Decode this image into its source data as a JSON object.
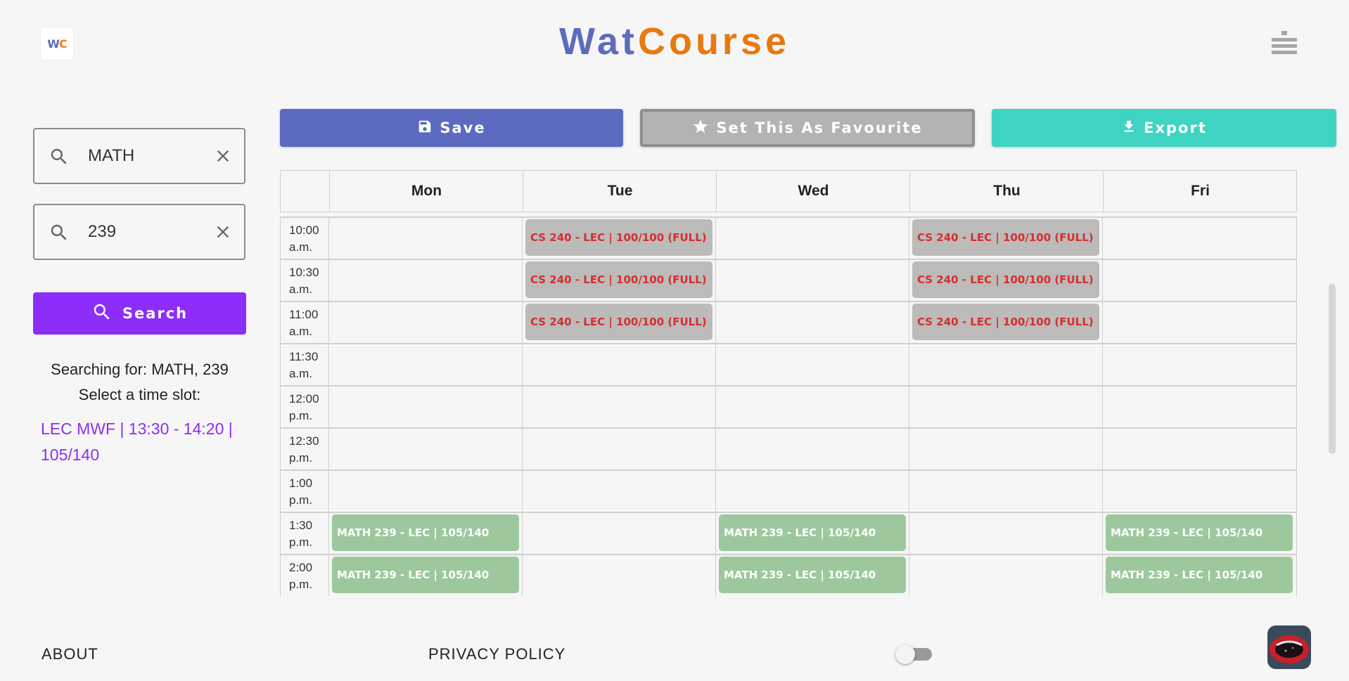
{
  "header": {
    "logo_text_w": "W",
    "logo_text_c": "C",
    "brand_part1": "Wat",
    "brand_part2": "Course",
    "menu_icon": "menu-icon"
  },
  "sidebar": {
    "search1": {
      "value": "MATH",
      "icon": "search-icon",
      "clear_icon": "close-icon"
    },
    "search2": {
      "value": "239",
      "icon": "search-icon",
      "clear_icon": "close-icon"
    },
    "search_button": "Search",
    "searching_for": "Searching for: MATH, 239",
    "select_prompt": "Select a time slot:",
    "time_slot": "LEC MWF | 13:30 - 14:20 | 105/140"
  },
  "toolbar": {
    "save": "Save",
    "favourite": "Set This As Favourite",
    "export": "Export"
  },
  "calendar": {
    "days": [
      "Mon",
      "Tue",
      "Wed",
      "Thu",
      "Fri"
    ],
    "rows": [
      {
        "time1": "10:00",
        "time2": "a.m.",
        "cells": [
          "",
          "CS 240 - LEC | 100/100 (FULL)",
          "",
          "CS 240 - LEC | 100/100 (FULL)",
          ""
        ]
      },
      {
        "time1": "10:30",
        "time2": "a.m.",
        "cells": [
          "",
          "CS 240 - LEC | 100/100 (FULL)",
          "",
          "CS 240 - LEC | 100/100 (FULL)",
          ""
        ]
      },
      {
        "time1": "11:00",
        "time2": "a.m.",
        "cells": [
          "",
          "CS 240 - LEC | 100/100 (FULL)",
          "",
          "CS 240 - LEC | 100/100 (FULL)",
          ""
        ]
      },
      {
        "time1": "11:30",
        "time2": "a.m.",
        "cells": [
          "",
          "",
          "",
          "",
          ""
        ]
      },
      {
        "time1": "12:00",
        "time2": "p.m.",
        "cells": [
          "",
          "",
          "",
          "",
          ""
        ]
      },
      {
        "time1": "12:30",
        "time2": "p.m.",
        "cells": [
          "",
          "",
          "",
          "",
          ""
        ]
      },
      {
        "time1": "1:00",
        "time2": "p.m.",
        "cells": [
          "",
          "",
          "",
          "",
          ""
        ]
      },
      {
        "time1": "1:30",
        "time2": "p.m.",
        "cells": [
          "MATH 239 - LEC | 105/140",
          "",
          "MATH 239 - LEC | 105/140",
          "",
          "MATH 239 - LEC | 105/140"
        ]
      },
      {
        "time1": "2:00",
        "time2": "p.m.",
        "cells": [
          "MATH 239 - LEC | 105/140",
          "",
          "MATH 239 - LEC | 105/140",
          "",
          "MATH 239 - LEC | 105/140"
        ]
      }
    ],
    "full_color": "#d32f2f",
    "full_bg": "#bdbaba",
    "open_bg": "#9dc89d"
  },
  "footer": {
    "about": "ABOUT",
    "privacy": "PRIVACY POLICY",
    "theme_toggle_on": false
  },
  "colors": {
    "brand_blue": "#5c6bc0",
    "brand_orange": "#e8790e",
    "search_purple": "#8c2dfa",
    "export_teal": "#3fd4c2"
  }
}
